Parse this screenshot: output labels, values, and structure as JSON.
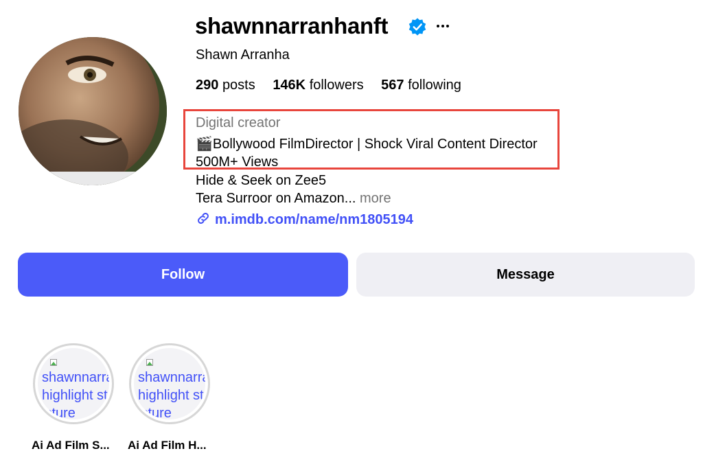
{
  "profile": {
    "username": "shawnnarranhanft",
    "full_name": "Shawn Arranha",
    "avatar_icon": "profile-photo",
    "verified_icon": "verified-badge-icon",
    "more_icon": "more-options-icon"
  },
  "stats": {
    "posts": {
      "count": "290",
      "label": "posts"
    },
    "followers": {
      "count": "146K",
      "label": "followers"
    },
    "following": {
      "count": "567",
      "label": "following"
    }
  },
  "bio": {
    "category": "Digital creator",
    "line1": "🎬Bollywood FilmDirector | Shock Viral Content Director",
    "line2": "500M+ Views",
    "line3": "Hide & Seek on Zee5",
    "line4": "Tera Surroor on Amazon...",
    "more": "more",
    "link": "m.imdb.com/name/nm1805194",
    "link_icon": "link-icon",
    "highlight_box_color": "#e8453c"
  },
  "actions": {
    "follow": "Follow",
    "message": "Message",
    "follow_color": "#4b5bf9",
    "message_color": "#efeff4"
  },
  "highlights": [
    {
      "alt": "shawnnarra\nhighlight st\nicture",
      "label": "Ai Ad Film S..."
    },
    {
      "alt": "shawnnarra\nhighlight st\nicture",
      "label": "Ai Ad Film H..."
    }
  ]
}
